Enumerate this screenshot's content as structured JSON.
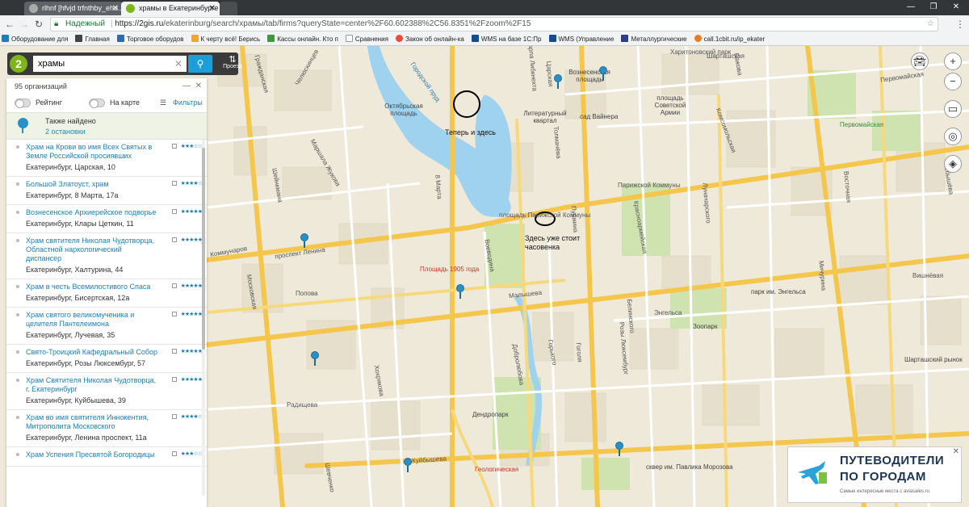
{
  "browser": {
    "tabs": [
      {
        "label": "rlhnf [hfvjd trfnthby_ehu..."
      },
      {
        "label": "храмы в Екатеринбурге"
      }
    ],
    "secure_label": "Надежный",
    "url_host": "https://2gis.ru",
    "url_path": "/ekaterinburg/search/храмы/tab/firms?queryState=center%2F60.602388%2C56.8351%2Fzoom%2F15",
    "bookmarks": [
      {
        "label": "Оборудование для"
      },
      {
        "label": "Главная"
      },
      {
        "label": "Торговое оборудов"
      },
      {
        "label": "К черту всё! Берись"
      },
      {
        "label": "Кассы онлайн. Кто п"
      },
      {
        "label": "Сравнения"
      },
      {
        "label": "Закон об онлайн-ка"
      },
      {
        "label": "WMS на базе 1С:Пр"
      },
      {
        "label": "WMS (Управление"
      },
      {
        "label": "Металлургические"
      },
      {
        "label": "call.1cbit.ru/ip_ekater"
      }
    ]
  },
  "search": {
    "value": "храмы",
    "route_label": "Проезд"
  },
  "panel": {
    "count_label": "95 организаций",
    "rating_label": "Рейтинг",
    "onmap_label": "На карте",
    "filters_label": "Фильтры",
    "also_found_title": "Также найдено",
    "also_found_link": "2 остановки",
    "results": [
      {
        "name": "Храм на Крови во имя Всех Святых в Земле Российской просиявших",
        "address": "Екатеринбург, Царская, 10",
        "stars": "★★★☆☆"
      },
      {
        "name": "Большой Златоуст, храм",
        "address": "Екатеринбург, 8 Марта, 17а",
        "stars": "★★★★☆"
      },
      {
        "name": "Вознесенское Архиерейское подворье",
        "address": "Екатеринбург, Клары Цеткин, 11",
        "stars": "★★★★★"
      },
      {
        "name": "Храм святителя Николая Чудотворца, Областной наркологический диспансер",
        "address": "Екатеринбург, Халтурина, 44",
        "stars": "★★★★★"
      },
      {
        "name": "Храм в честь Всемилостивого Спаса",
        "address": "Екатеринбург, Бисертская, 12а",
        "stars": "★★★★★"
      },
      {
        "name": "Храм святого великомученика и целителя Пантелеимона",
        "address": "Екатеринбург, Лучевая, 35",
        "stars": "★★★★★"
      },
      {
        "name": "Свято-Троицкий Кафедральный Собор",
        "address": "Екатеринбург, Розы Люксембург, 57",
        "stars": "★★★★★"
      },
      {
        "name": "Храм Святителя Николая Чудотворца, г. Екатеринбург",
        "address": "Екатеринбург, Куйбышева, 39",
        "stars": "★★★★★"
      },
      {
        "name": "Храм во имя святителя Иннокентия, Митрополита Московского",
        "address": "Екатеринбург, Ленина проспект, 11а",
        "stars": "★★★★☆"
      },
      {
        "name": "Храм Успения Пресвятой Богородицы",
        "address": "",
        "stars": "★★★☆☆"
      }
    ]
  },
  "map": {
    "annotations": {
      "note1": "Теперь и здесь",
      "note2": "Здесь уже стоит часовенка"
    },
    "streets": [
      "Челюскинцев",
      "Городской пруд",
      "Октябрьская площадь",
      "Литературный квартал",
      "Вознесенская площадь",
      "Харитоновский парк",
      "Шарташская",
      "Первомайская",
      "сад Вайнера",
      "площадь Советской Армии",
      "Первомайская",
      "проспект Ленина",
      "Парижской Коммуны",
      "площадь Парижской Коммуны",
      "Малышева",
      "Куйбышева",
      "Радищева",
      "Попова",
      "Московская",
      "Шейнкмана",
      "Хохрякова",
      "8 Марта",
      "Воеводина",
      "Добролюбова",
      "Горького",
      "Гоголя",
      "Розы Люксембург",
      "Белинского",
      "Луначарского",
      "Энгельса",
      "Зоопарк",
      "парк им. Энгельса",
      "Мичурина",
      "Восточная",
      "Бажова",
      "Шарташский рынок",
      "Вишнёвая",
      "Чебышёва",
      "Маршала Жукова",
      "Толмачёва",
      "Красноармейская",
      "Комсомольская",
      "Дендропарк",
      "сквер им. Павлика Морозова",
      "Пушкина",
      "Коммунаров",
      "Карла Либкнехта",
      "Царская",
      "Гражданская",
      "Шевченко"
    ],
    "metro": [
      "Площадь 1905 года",
      "Геологическая"
    ]
  },
  "ad": {
    "line1": "ПУТЕВОДИТЕЛИ",
    "line2": "ПО ГОРОДАМ",
    "line3": "Самые интересные места с aviasales.ru"
  }
}
